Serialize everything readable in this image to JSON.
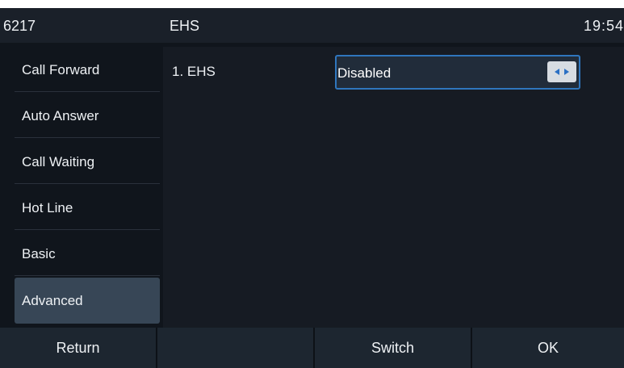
{
  "status_bar": {
    "account": "6217",
    "page_title": "EHS",
    "time": "19:54"
  },
  "sidebar": {
    "items": [
      {
        "label": "Call Forward"
      },
      {
        "label": "Auto Answer"
      },
      {
        "label": "Call Waiting"
      },
      {
        "label": "Hot Line"
      },
      {
        "label": "Basic"
      },
      {
        "label": "Advanced"
      }
    ],
    "selected_index": 5
  },
  "main": {
    "setting_label": "1. EHS",
    "setting_value": "Disabled",
    "arrow_icon": "left-right-arrows-icon"
  },
  "softkeys": [
    "Return",
    "",
    "Switch",
    "OK"
  ],
  "colors": {
    "accent": "#2f76bd",
    "arrow": "#2a6fc4",
    "background": "#10151c",
    "selected": "#374656"
  }
}
